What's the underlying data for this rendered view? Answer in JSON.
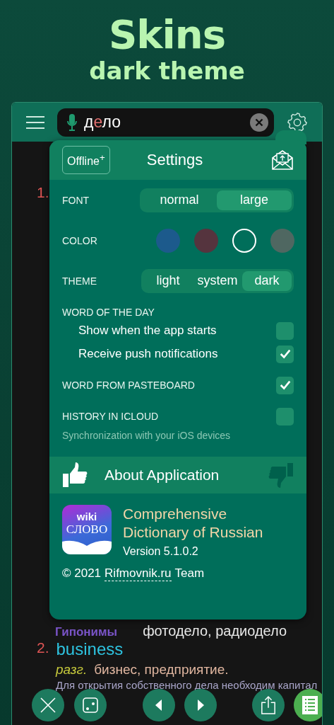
{
  "header": {
    "title": "Skins",
    "subtitle": "dark theme"
  },
  "search": {
    "parts": [
      {
        "text": "д",
        "stressed": false
      },
      {
        "text": "е",
        "stressed": true
      },
      {
        "text": "ло",
        "stressed": false
      }
    ]
  },
  "entries": [
    {
      "number": "1."
    },
    {
      "label": "Гипонимы",
      "value": "фотодело, радиодело"
    },
    {
      "number": "2.",
      "translation": "business",
      "note": "разг.",
      "synonyms": "бизнес, предприятие.",
      "example": "Для открытия собственного дела необходим капитал"
    }
  ],
  "settings": {
    "badge": "Offline$^{+}$",
    "title": "Settings",
    "font": {
      "label": "FONT",
      "options": [
        {
          "label": "normal",
          "selected": false
        },
        {
          "label": "large",
          "selected": true
        }
      ]
    },
    "color": {
      "label": "COLOR",
      "swatches": [
        {
          "color": "#1c5a8c",
          "selected": false
        },
        {
          "color": "#55343e",
          "selected": false
        },
        {
          "color": "#006e5a",
          "selected": true
        },
        {
          "color": "#4f6761",
          "selected": false
        }
      ]
    },
    "theme": {
      "label": "THEME",
      "options": [
        {
          "label": "light",
          "selected": false
        },
        {
          "label": "system",
          "selected": false
        },
        {
          "label": "dark",
          "selected": true
        }
      ]
    },
    "word_of_the_day": {
      "label": "WORD OF THE DAY",
      "items": [
        {
          "label": "Show when the app starts",
          "checked": false
        },
        {
          "label": "Receive push notifications",
          "checked": true
        }
      ]
    },
    "pasteboard": {
      "label": "WORD FROM PASTEBOARD",
      "checked": true
    },
    "icloud": {
      "label": "HISTORY IN ICLOUD",
      "checked": false,
      "note": "Synchronization with your iOS devices"
    },
    "about": {
      "title": "About Application",
      "icon_top": "wiki",
      "icon_bottom": "СЛОВО",
      "name_lines": [
        "Comprehensive",
        "Dictionary of Russian"
      ],
      "version": "Version 5.1.0.2",
      "copyright": "© 2021",
      "link": "Rifmovnik.ru",
      "team": "Team"
    }
  },
  "toolbar": [
    {
      "kind": "close",
      "selected": false
    },
    {
      "kind": "dice",
      "selected": false
    },
    {
      "kind": "prev",
      "selected": false
    },
    {
      "kind": "next",
      "selected": false
    },
    {
      "kind": "share",
      "selected": false
    },
    {
      "kind": "list",
      "selected": true
    }
  ]
}
